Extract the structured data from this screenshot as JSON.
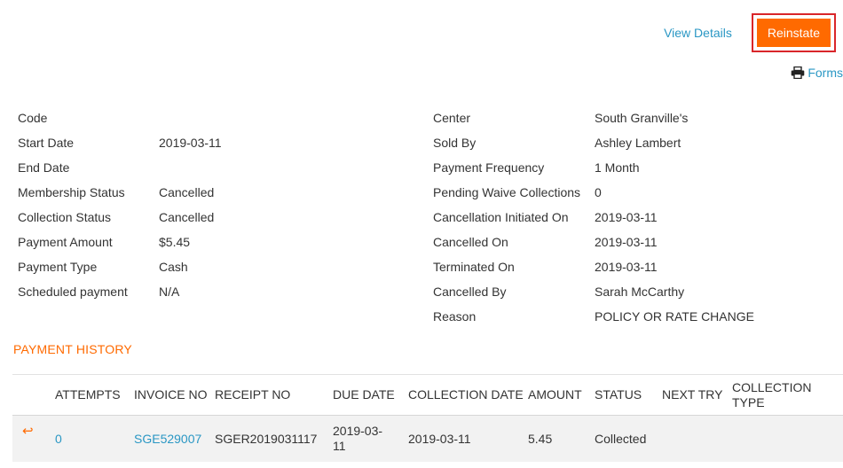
{
  "header": {
    "view_details_label": "View Details",
    "reinstate_label": "Reinstate",
    "forms_label": "Forms"
  },
  "details_left": [
    {
      "label": "Code",
      "value": ""
    },
    {
      "label": "Start Date",
      "value": "2019-03-11"
    },
    {
      "label": "End Date",
      "value": ""
    },
    {
      "label": "Membership Status",
      "value": "Cancelled"
    },
    {
      "label": "Collection Status",
      "value": "Cancelled"
    },
    {
      "label": "Payment Amount",
      "value": "$5.45"
    },
    {
      "label": "Payment Type",
      "value": "Cash"
    },
    {
      "label": "Scheduled payment",
      "value": "N/A"
    }
  ],
  "details_right": [
    {
      "label": "Center",
      "value": "South Granville's"
    },
    {
      "label": "Sold By",
      "value": "Ashley Lambert"
    },
    {
      "label": "Payment Frequency",
      "value": "1 Month"
    },
    {
      "label": "Pending Waive Collections",
      "value": "0"
    },
    {
      "label": "Cancellation Initiated On",
      "value": "2019-03-11"
    },
    {
      "label": "Cancelled On",
      "value": "2019-03-11"
    },
    {
      "label": "Terminated On",
      "value": "2019-03-11"
    },
    {
      "label": "Cancelled By",
      "value": "Sarah McCarthy"
    },
    {
      "label": "Reason",
      "value": "POLICY OR RATE CHANGE"
    }
  ],
  "payment_history": {
    "title": "PAYMENT HISTORY",
    "headers": {
      "attempts": "ATTEMPTS",
      "invoice_no": "INVOICE NO",
      "receipt_no": "RECEIPT NO",
      "due_date": "DUE DATE",
      "collection_date": "COLLECTION DATE",
      "amount": "AMOUNT",
      "status": "STATUS",
      "next_try": "NEXT TRY",
      "collection_type": "COLLECTION TYPE"
    },
    "rows": [
      {
        "attempts": "0",
        "invoice_no": "SGE529007",
        "receipt_no": "SGER2019031117",
        "due_date": "2019-03-11",
        "collection_date": "2019-03-11",
        "amount": "5.45",
        "status": "Collected",
        "next_try": "",
        "collection_type": ""
      }
    ]
  },
  "colors": {
    "accent_orange": "#ff6a00",
    "link_blue": "#2a97c4",
    "highlight_red": "#d9262a"
  }
}
